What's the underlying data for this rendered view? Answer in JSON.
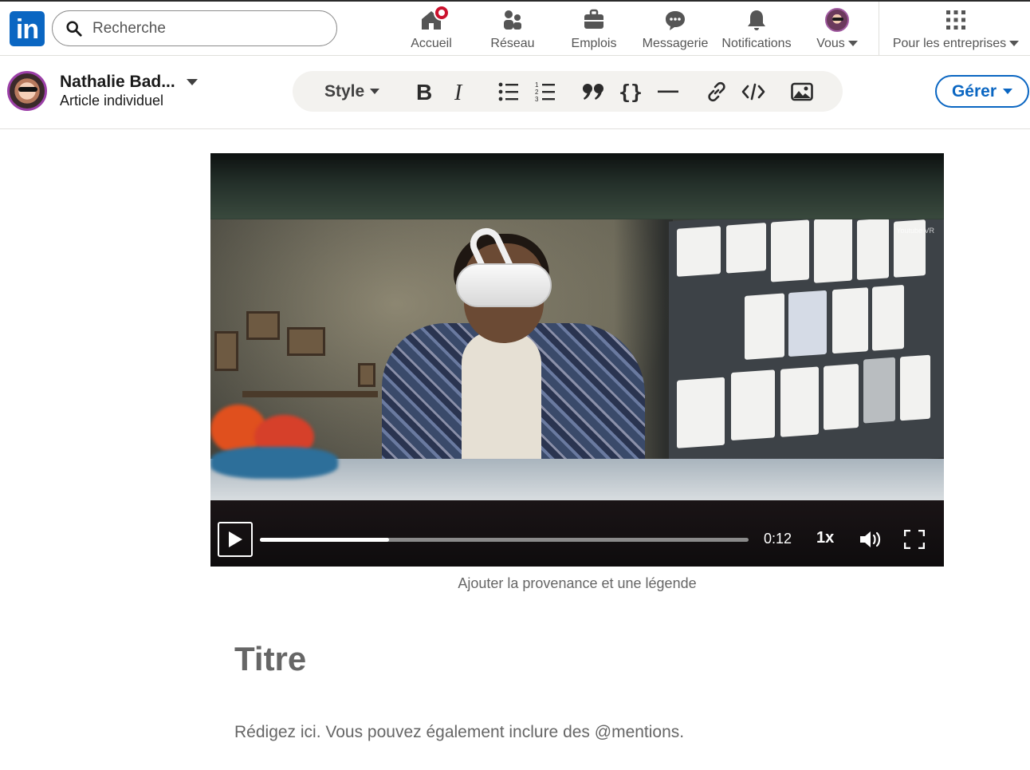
{
  "nav": {
    "search_placeholder": "Recherche",
    "items": [
      {
        "label": "Accueil",
        "icon": "home-icon",
        "has_badge": true
      },
      {
        "label": "Réseau",
        "icon": "people-icon"
      },
      {
        "label": "Emplois",
        "icon": "briefcase-icon"
      },
      {
        "label": "Messagerie",
        "icon": "chat-icon"
      },
      {
        "label": "Notifications",
        "icon": "bell-icon"
      },
      {
        "label": "Vous",
        "icon": "avatar"
      },
      {
        "label": "Pour les entreprises",
        "icon": "grid-icon"
      }
    ],
    "brand_color": "#0a66c2",
    "badge_color": "#cb112d"
  },
  "author": {
    "name": "Nathalie Bad...",
    "subtitle": "Article individuel"
  },
  "toolbar": {
    "style_label": "Style",
    "buttons": [
      "bold-icon",
      "italic-icon",
      "bullet-list-icon",
      "numbered-list-icon",
      "quote-icon",
      "code-block-icon",
      "divider-icon",
      "link-icon",
      "embed-icon",
      "image-icon"
    ]
  },
  "manage_button": "Gérer",
  "video": {
    "watermark": "Youtube VR",
    "time": "0:12",
    "speed": "1x",
    "progress": 0.265
  },
  "caption_placeholder": "Ajouter la provenance et une légende",
  "title_placeholder": "Titre",
  "body_placeholder": "Rédigez ici. Vous pouvez également inclure des @mentions."
}
